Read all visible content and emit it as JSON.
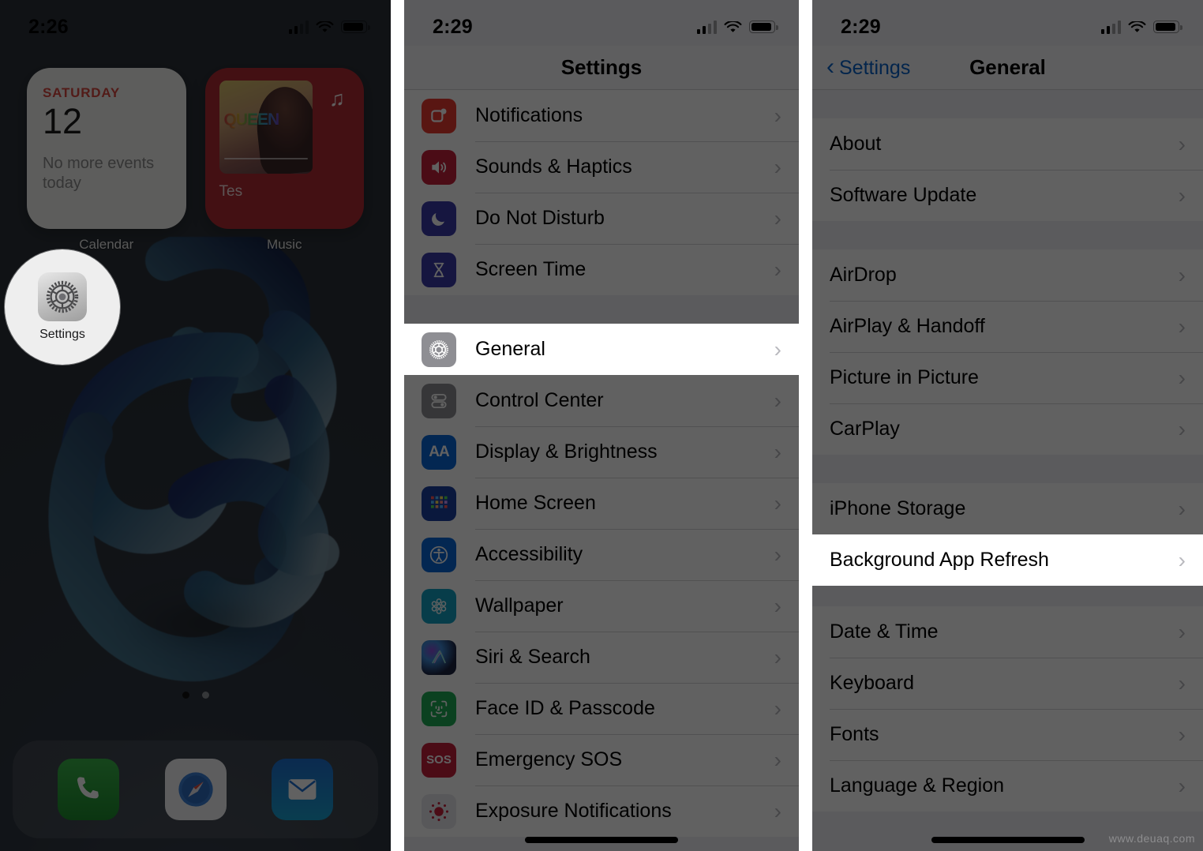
{
  "panels": {
    "home": {
      "status": {
        "time": "2:26",
        "signal_icon": "cellular-bars-icon",
        "wifi_icon": "wifi-icon",
        "battery_icon": "battery-icon"
      },
      "widgets": [
        {
          "type": "calendar",
          "label": "Calendar",
          "day": "SATURDAY",
          "date": "12",
          "note": "No more events today"
        },
        {
          "type": "music",
          "label": "Music",
          "track": "Tes",
          "album_art_text": "QUEEN",
          "badge_icon": "music-note-icon"
        }
      ],
      "app": {
        "label": "Settings",
        "icon": "gear-icon"
      },
      "page_dots": {
        "count": 2,
        "active": 1
      },
      "dock": [
        {
          "label": "Phone",
          "icon": "phone-icon"
        },
        {
          "label": "Safari",
          "icon": "compass-icon"
        },
        {
          "label": "Mail",
          "icon": "envelope-icon"
        }
      ]
    },
    "settings": {
      "status": {
        "time": "2:29"
      },
      "title": "Settings",
      "groups": [
        {
          "rows": [
            {
              "label": "Notifications",
              "icon": "notifications-icon",
              "icon_class": "i-notif",
              "glyph": "▣",
              "spot": false
            },
            {
              "label": "Sounds & Haptics",
              "icon": "speaker-icon",
              "icon_class": "i-sound",
              "glyph": "🔊",
              "spot": false
            },
            {
              "label": "Do Not Disturb",
              "icon": "moon-icon",
              "icon_class": "i-dnd",
              "glyph": "☾",
              "spot": false
            },
            {
              "label": "Screen Time",
              "icon": "hourglass-icon",
              "icon_class": "i-screen",
              "glyph": "⌛",
              "spot": false
            }
          ]
        },
        {
          "rows": [
            {
              "label": "General",
              "icon": "gear-icon",
              "icon_class": "i-general",
              "glyph": "⚙",
              "spot": true
            }
          ]
        },
        {
          "rows": [
            {
              "label": "Control Center",
              "icon": "toggles-icon",
              "icon_class": "i-cc",
              "glyph": "≡",
              "spot": false
            },
            {
              "label": "Display & Brightness",
              "icon": "text-size-icon",
              "icon_class": "i-display",
              "glyph": "AA",
              "spot": false
            },
            {
              "label": "Home Screen",
              "icon": "app-grid-icon",
              "icon_class": "i-home",
              "glyph": "∷",
              "spot": false
            },
            {
              "label": "Accessibility",
              "icon": "accessibility-icon",
              "icon_class": "i-access",
              "glyph": "ⓘ",
              "spot": false
            },
            {
              "label": "Wallpaper",
              "icon": "flower-icon",
              "icon_class": "i-wall",
              "glyph": "✿",
              "spot": false
            },
            {
              "label": "Siri & Search",
              "icon": "siri-icon",
              "icon_class": "i-siri",
              "glyph": "◎",
              "spot": false
            },
            {
              "label": "Face ID & Passcode",
              "icon": "face-id-icon",
              "icon_class": "i-face",
              "glyph": "☺",
              "spot": false
            },
            {
              "label": "Emergency SOS",
              "icon": "sos-icon",
              "icon_class": "i-sos",
              "glyph": "SOS",
              "spot": false
            },
            {
              "label": "Exposure Notifications",
              "icon": "exposure-icon",
              "icon_class": "i-expo",
              "glyph": "⬤",
              "spot": false
            }
          ]
        }
      ]
    },
    "general": {
      "status": {
        "time": "2:29"
      },
      "back_label": "Settings",
      "title": "General",
      "groups": [
        {
          "rows": [
            {
              "label": "About",
              "spot": false
            },
            {
              "label": "Software Update",
              "spot": false
            }
          ]
        },
        {
          "rows": [
            {
              "label": "AirDrop",
              "spot": false
            },
            {
              "label": "AirPlay & Handoff",
              "spot": false
            },
            {
              "label": "Picture in Picture",
              "spot": false
            },
            {
              "label": "CarPlay",
              "spot": false
            }
          ]
        },
        {
          "rows": [
            {
              "label": "iPhone Storage",
              "spot": false
            }
          ]
        },
        {
          "rows": [
            {
              "label": "Background App Refresh",
              "spot": true
            }
          ]
        },
        {
          "rows": [
            {
              "label": "Date & Time",
              "spot": false
            },
            {
              "label": "Keyboard",
              "spot": false
            },
            {
              "label": "Fonts",
              "spot": false
            },
            {
              "label": "Language & Region",
              "spot": false
            }
          ]
        }
      ],
      "watermark": "www.deuaq.com"
    }
  },
  "colors": {
    "accent_blue": "#0a62c9",
    "list_bg": "#efeff4",
    "row_bg": "#ffffff",
    "dim": "rgba(0,0,0,0.62)",
    "music_widget": "#b02b34",
    "calendar_red": "#d8473f"
  }
}
